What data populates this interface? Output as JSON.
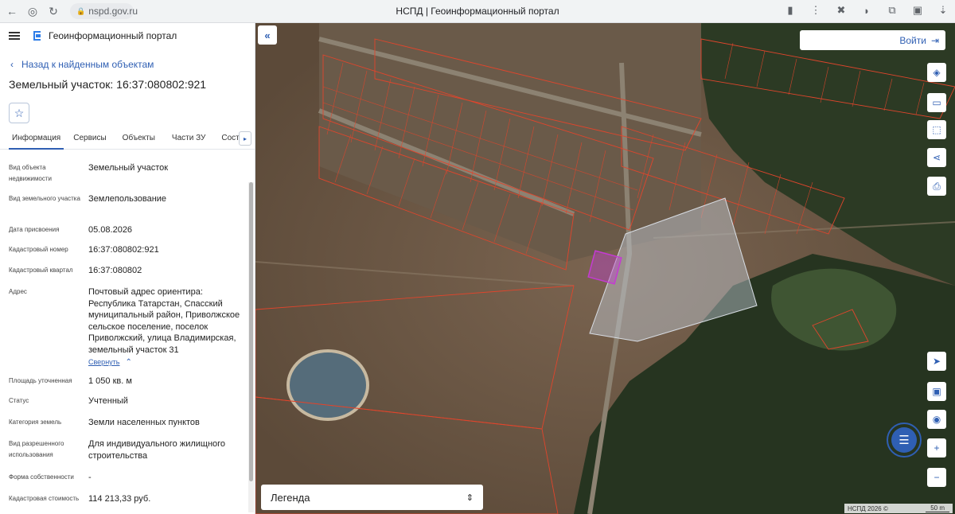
{
  "browser": {
    "url": "nspd.gov.ru",
    "tab_title": "НСПД | Геоинформационный портал"
  },
  "app": {
    "title": "Геоинформационный портал"
  },
  "sidebar": {
    "back_label": "Назад к найденным объектам",
    "object_title": "Земельный участок: 16:37:080802:921",
    "tabs": [
      "Информация",
      "Сервисы",
      "Объекты",
      "Части ЗУ",
      "Состав"
    ],
    "active_tab": "Информация",
    "properties": [
      {
        "key": "Вид объекта недвижимости",
        "value": "Земельный участок"
      },
      {
        "key": "Вид земельного участка",
        "value": "Землепользование"
      },
      {
        "key": "Дата присвоения",
        "value": "05.08.2026"
      },
      {
        "key": "Кадастровый номер",
        "value": "16:37:080802:921"
      },
      {
        "key": "Кадастровый квартал",
        "value": "16:37:080802"
      },
      {
        "key": "Адрес",
        "value": "Почтовый адрес ориентира: Республика Татарстан, Спасский муниципальный район, Приволжское сельское поселение, поселок Приволжский, улица Владимирская, земельный участок 31"
      },
      {
        "key": "Площадь уточненная",
        "value": "1 050 кв. м"
      },
      {
        "key": "Статус",
        "value": "Учтенный"
      },
      {
        "key": "Категория земель",
        "value": "Земли населенных пунктов"
      },
      {
        "key": "Вид разрешенного использования",
        "value": "Для индивидуального жилищного строительства"
      },
      {
        "key": "Форма собственности",
        "value": "-"
      },
      {
        "key": "Кадастровая стоимость",
        "value": "114 213,33 руб."
      }
    ],
    "collapse_label": "Свернуть"
  },
  "map": {
    "login_label": "Войти",
    "legend_label": "Легенда",
    "attribution": "НСПД 2026 ©",
    "scale_label": "50 m"
  },
  "colors": {
    "accent": "#2f5fb3",
    "parcel_outline": "#e0452c",
    "selected_parcel": "#c43bd2"
  }
}
